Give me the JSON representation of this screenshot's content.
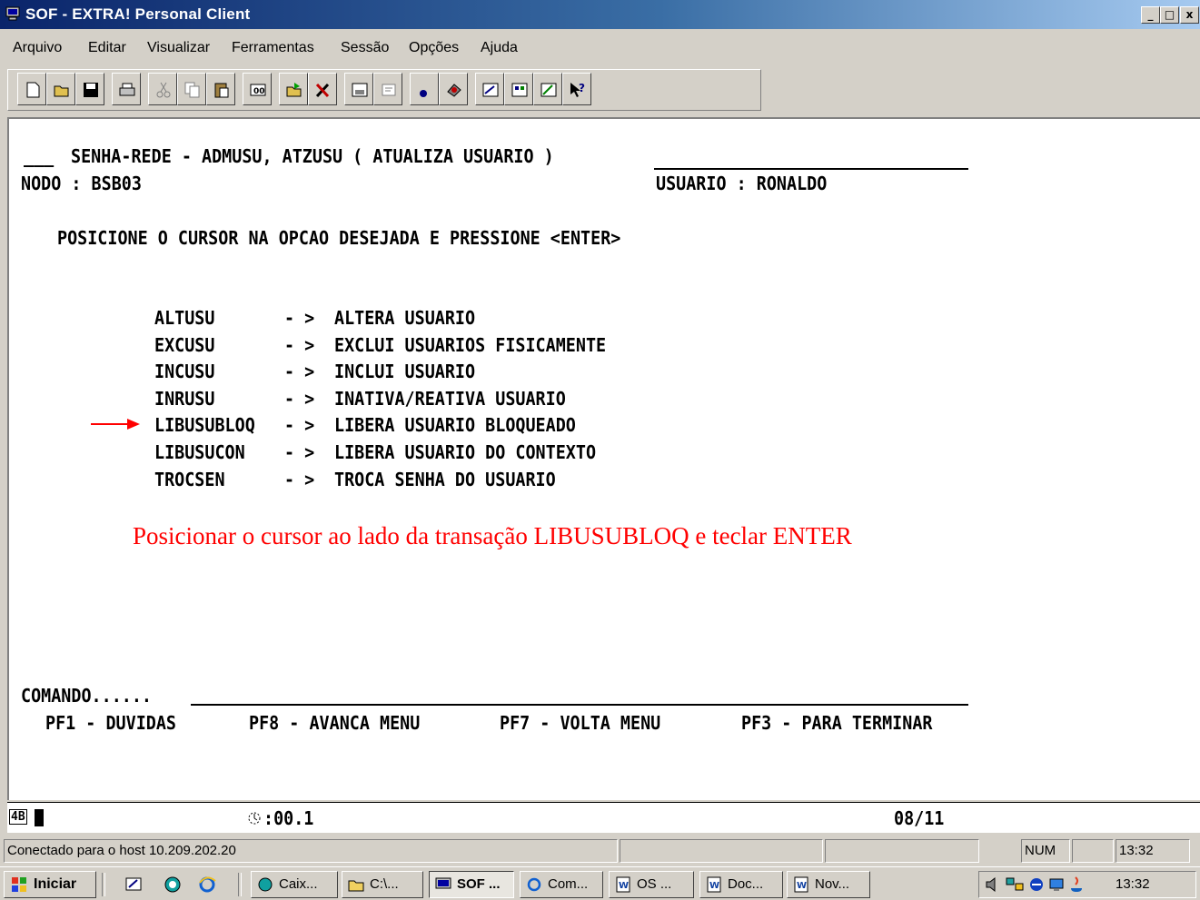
{
  "window": {
    "title": "SOF - EXTRA! Personal Client",
    "controls": [
      "_",
      "□",
      "x"
    ]
  },
  "menu": [
    "Arquivo",
    "Editar",
    "Visualizar",
    "Ferramentas",
    "Sessão",
    "Opções",
    "Ajuda"
  ],
  "toolbar": {
    "icons": [
      "new-icon",
      "open-icon",
      "save-icon",
      "print-icon",
      "cut-icon",
      "copy-icon",
      "paste-icon",
      "trace-icon",
      "send-file-icon",
      "tools-icon",
      "macro-icon",
      "receive-icon",
      "record-icon",
      "settings-icon",
      "quick-pad-icon",
      "display-icon",
      "edit-icon",
      "help-icon"
    ]
  },
  "screen": {
    "header_prefix": "___",
    "header_title": "SENHA-REDE - ADMUSU, ATZUSU ( ATUALIZA USUARIO )",
    "node_label": "NODO : BSB03",
    "user_label": "USUARIO : RONALDO",
    "instruction": "POSICIONE O CURSOR NA OPCAO DESEJADA E PRESSIONE <ENTER>",
    "options": [
      {
        "code": "ALTUSU",
        "arrow": "- >",
        "desc": "ALTERA USUARIO"
      },
      {
        "code": "EXCUSU",
        "arrow": "- >",
        "desc": "EXCLUI USUARIOS FISICAMENTE"
      },
      {
        "code": "INCUSU",
        "arrow": "- >",
        "desc": "INCLUI USUARIO"
      },
      {
        "code": "INRUSU",
        "arrow": "- >",
        "desc": "INATIVA/REATIVA USUARIO"
      },
      {
        "code": "LIBUSUBLOQ",
        "arrow": "- >",
        "desc": "LIBERA USUARIO BLOQUEADO"
      },
      {
        "code": "LIBUSUCON",
        "arrow": "- >",
        "desc": "LIBERA USUARIO DO CONTEXTO"
      },
      {
        "code": "TROCSEN",
        "arrow": "- >",
        "desc": "TROCA SENHA DO USUARIO"
      }
    ],
    "annotation": "Posicionar o cursor ao lado da transação LIBUSUBLOQ e teclar ENTER",
    "annotation_color": "#ff0000",
    "command_label": "COMANDO......",
    "pf_keys": [
      "PF1 - DUVIDAS",
      "PF8 - AVANCA MENU",
      "PF7 - VOLTA MENU",
      "PF3 - PARA TERMINAR"
    ]
  },
  "oia": {
    "session": "4B",
    "timer": ":00.1",
    "cursor_pos": "08/11"
  },
  "statusbar": {
    "connection": "Conectado para o host 10.209.202.20",
    "num": "NUM",
    "time": "13:32"
  },
  "taskbar": {
    "start_label": "Iniciar",
    "tasks": [
      "Caix...",
      "C:\\...",
      "SOF ...",
      "Com...",
      "OS ...",
      "Doc...",
      "Nov..."
    ],
    "clock": "13:32"
  }
}
